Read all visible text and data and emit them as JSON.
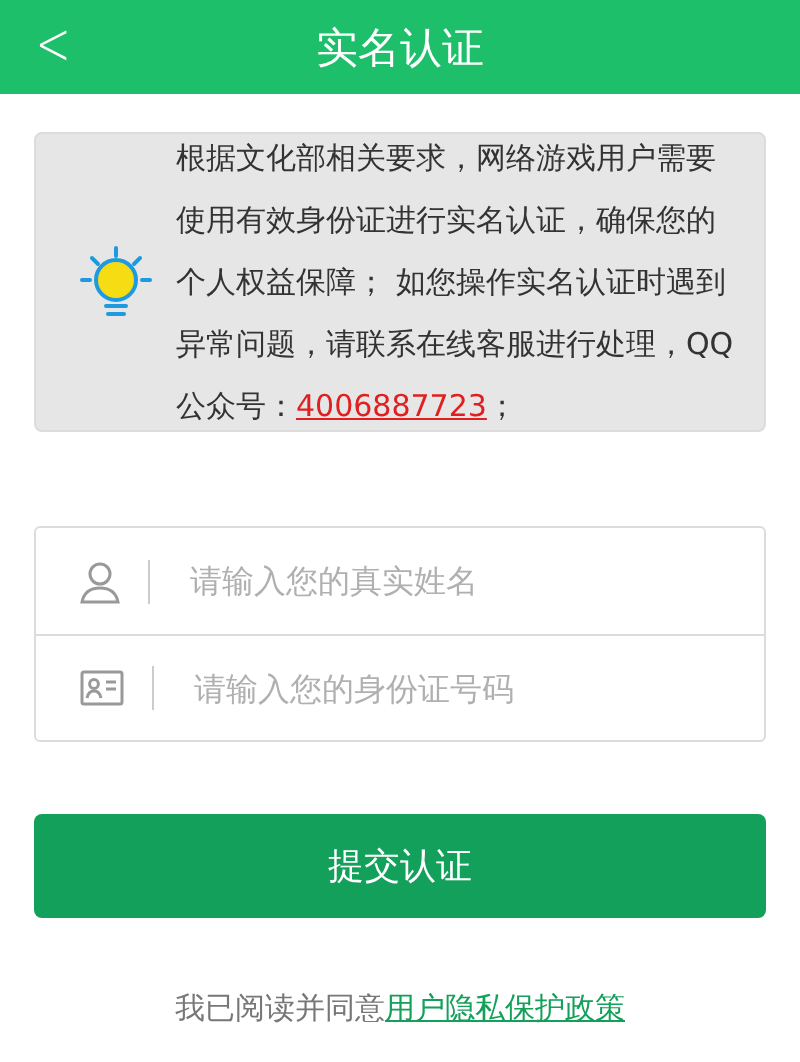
{
  "header": {
    "back": "<",
    "title": "实名认证"
  },
  "notice": {
    "text": "根据文化部相关要求，网络游戏用户需要使用有效身份证进行实名认证，确保您的个人权益保障； 如您操作实名认证时遇到异常问题，请联系在线客服进行处理，QQ公众号：",
    "phone": "4006887723",
    "suffix": "；"
  },
  "fields": [
    {
      "kind": "person",
      "placeholder": "请输入您的真实姓名"
    },
    {
      "kind": "idcard",
      "placeholder": "请输入您的身份证号码"
    }
  ],
  "submit": "提交认证",
  "agreement": {
    "text": "我已阅读并同意",
    "link": "用户隐私保护政策"
  }
}
